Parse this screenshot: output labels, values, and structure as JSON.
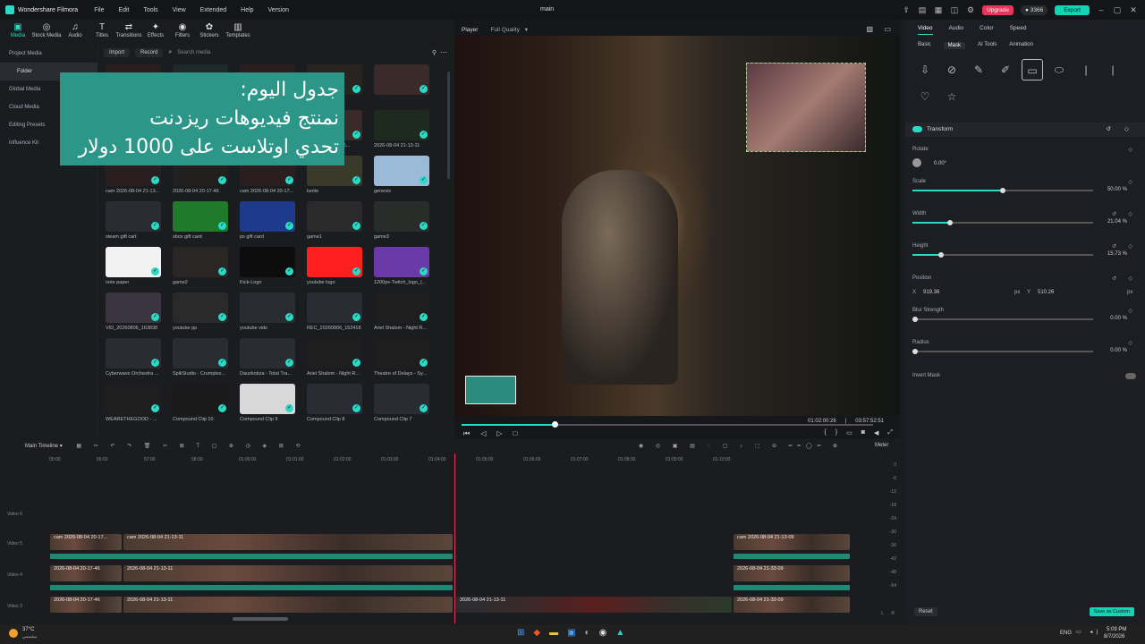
{
  "app": {
    "name": "Wondershare Filmora",
    "document": "main",
    "menu": [
      "File",
      "Edit",
      "Tools",
      "View",
      "Extended",
      "Help",
      "Version"
    ],
    "upgrade": "Upgrade",
    "coins": "3366",
    "export": "Export"
  },
  "toolbar": [
    "Media",
    "Stock Media",
    "Audio",
    "Titles",
    "Transitions",
    "Effects",
    "Filters",
    "Stickers",
    "Templates"
  ],
  "sidebar": [
    "Project Media",
    "Folder",
    "Global Media",
    "Cloud Media",
    "Editing Presets",
    "Influence Kit"
  ],
  "media": {
    "import": "Import",
    "record": "Record",
    "search_placeholder": "Search media",
    "tiles": [
      {
        "cap": "",
        "thumb": "#2a1e20"
      },
      {
        "cap": "",
        "thumb": "#1e2a2a"
      },
      {
        "cap": "",
        "thumb": "#2a1e20"
      },
      {
        "cap": "",
        "thumb": "#2a2420"
      },
      {
        "cap": "",
        "thumb": "#3a2a2a"
      },
      {
        "cap": "",
        "thumb": "#2a1e20"
      },
      {
        "cap": "",
        "thumb": "#2a2a2a"
      },
      {
        "cap": "",
        "thumb": "#2a1e20"
      },
      {
        "cap": "2026-08-05 00-56...",
        "thumb": "#3a2a2a"
      },
      {
        "cap": "2026-08-04 21-13-11",
        "thumb": "#1e2a1e"
      },
      {
        "cap": "cam 2026-08-04 21-13...",
        "thumb": "#2a1e20"
      },
      {
        "cap": "2026-08-04 20-17-46",
        "thumb": "#22201e"
      },
      {
        "cap": "cam 2026-08-04 20-17...",
        "thumb": "#2a1e20"
      },
      {
        "cap": "lunite",
        "thumb": "#3a3a2a"
      },
      {
        "cap": "genesis",
        "thumb": "#9bbad8"
      },
      {
        "cap": "steam gift cart",
        "thumb": "#2a2c33"
      },
      {
        "cap": "xbox gift card",
        "thumb": "#1f7a2a"
      },
      {
        "cap": "ps gift card",
        "thumb": "#1e3a8a"
      },
      {
        "cap": "game1",
        "thumb": "#2a2a2a"
      },
      {
        "cap": "game3",
        "thumb": "#2a2c2a"
      },
      {
        "cap": "note paper",
        "thumb": "#f2f2f2"
      },
      {
        "cap": "game2",
        "thumb": "#2a2626"
      },
      {
        "cap": "Kick-Logo",
        "thumb": "#0d0d0d"
      },
      {
        "cap": "youtube logo",
        "thumb": "#ff1f1f"
      },
      {
        "cap": "1200px-Twitch_logo_(...",
        "thumb": "#6a3aa8"
      },
      {
        "cap": "VID_20260806_163838",
        "thumb": "#3a3540"
      },
      {
        "cap": "youtube pp",
        "thumb": "#2a2a2a"
      },
      {
        "cap": "youtube vids",
        "thumb": "#2a2c33"
      },
      {
        "cap": "REC_20260806_152418",
        "thumb": "#2a2c33"
      },
      {
        "cap": "Ariel Shalom - Night R...",
        "thumb": "#1e1e1e"
      },
      {
        "cap": "Cyberwave Orchestra ...",
        "thumb": "#2a2c33"
      },
      {
        "cap": "SpliiStudio - Crumples...",
        "thumb": "#2a2c33"
      },
      {
        "cap": "Dauzkobza - Total Tra...",
        "thumb": "#2a2c33"
      },
      {
        "cap": "Ariel Shalom - Night R...",
        "thumb": "#1e1e1e"
      },
      {
        "cap": "Theatre of Delays - Sy...",
        "thumb": "#1e1e1e"
      },
      {
        "cap": "WEARETHEGOOD - ...",
        "thumb": "#1e1e1e"
      },
      {
        "cap": "Compound Clip 10",
        "thumb": "#1a1a1a"
      },
      {
        "cap": "Compound Clip 9",
        "thumb": "#d8d8d8"
      },
      {
        "cap": "Compound Clip 8",
        "thumb": "#2a2c33"
      },
      {
        "cap": "Compound Clip 7",
        "thumb": "#2a2c33"
      }
    ]
  },
  "overlay": {
    "line1": "جدول اليوم:",
    "line2": "نمنتج فيديوهات ريزدنت",
    "line3": "تحدي اوتلاست على 1000 دولار"
  },
  "player": {
    "label": "Player",
    "quality": "Full Quality",
    "current": "01:02:00:26",
    "total": "03:57:52:51",
    "progress": 0.226
  },
  "props": {
    "tabs": [
      "Video",
      "Audio",
      "Color",
      "Speed"
    ],
    "subtabs": [
      "Basic",
      "Mask",
      "AI Tools",
      "Animation"
    ],
    "section": "Transform",
    "rotate": {
      "label": "Rotate",
      "value": "0.00°"
    },
    "scale": {
      "label": "Scale",
      "value": "50.00",
      "unit": "%",
      "level": 0.5
    },
    "width": {
      "label": "Width",
      "value": "21.04",
      "unit": "%",
      "level": 0.21
    },
    "height": {
      "label": "Height",
      "value": "15.73",
      "unit": "%",
      "level": 0.157
    },
    "position": {
      "label": "Position",
      "x": "919.36",
      "y": "510.26",
      "unit": "px"
    },
    "blur": {
      "label": "Blur Strength",
      "value": "0.00",
      "unit": "%"
    },
    "radius": {
      "label": "Radius",
      "value": "0.00",
      "unit": "%"
    },
    "invert": "Invert Mask",
    "reset": "Reset",
    "save": "Save as Custom"
  },
  "timeline": {
    "name": "Main Timeline",
    "meter": "Meter",
    "ruler": [
      "00:00",
      "55:00",
      "57:00",
      "58:00",
      "01:00:00",
      "01:01:00",
      "01:02:00",
      "01:03:00",
      "01:04:00",
      "01:05:00",
      "01:06:00",
      "01:07:00",
      "01:08:00",
      "01:09:00",
      "01:10:00"
    ],
    "tracks": [
      "Video 6",
      "Video 5",
      "Video 4",
      "Video 3"
    ],
    "clips": [
      "cam 2026-08-04 20-17...",
      "cam 2026-08-04 21-13-11",
      "cam 2026-08-04 21-13-09",
      "2026-08-04 20-17-46",
      "2026-08-04 21-13-11",
      "2026-08-04 21-33-09",
      "2026-08-04 20-17-46",
      "2026-08-04 21-13-11",
      "2026-08-04 21-13-11",
      "2026-08-04 21-33-09"
    ],
    "meter_labels": [
      "0",
      "-6",
      "-12",
      "-18",
      "-24",
      "-30",
      "-36",
      "-42",
      "-48",
      "-54"
    ]
  },
  "taskbar": {
    "temp": "37°C",
    "weather": "مشمس",
    "lang": "ENG",
    "time": "5:09 PM",
    "date": "8/7/2026"
  }
}
